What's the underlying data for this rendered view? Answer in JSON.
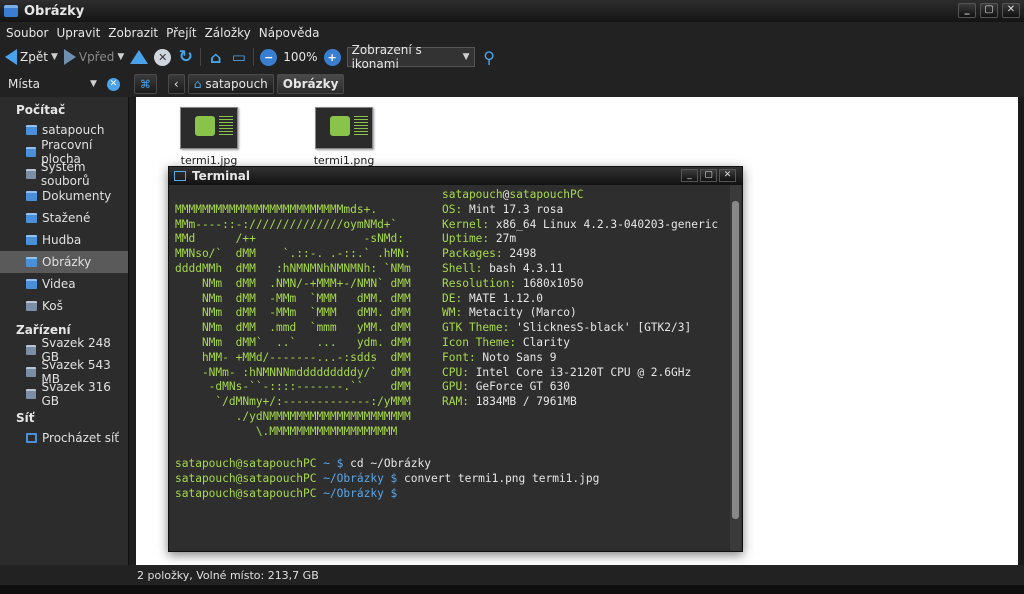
{
  "window": {
    "title": "Obrázky",
    "buttons": [
      "_",
      "▢",
      "✕"
    ]
  },
  "menu": [
    "Soubor",
    "Upravit",
    "Zobrazit",
    "Přejít",
    "Záložky",
    "Nápověda"
  ],
  "toolbar": {
    "back_label": "Zpět",
    "forward_label": "Vpřed",
    "zoom_level": "100%",
    "view_mode": "Zobrazení s ikonami"
  },
  "location": {
    "places_label": "Místa",
    "breadcrumbs": [
      "satapouch",
      "Obrázky"
    ]
  },
  "sidebar": {
    "sections": [
      {
        "title": "Počítač",
        "items": [
          {
            "label": "satapouch",
            "icon": "home-folder-icon"
          },
          {
            "label": "Pracovní plocha",
            "icon": "desktop-icon"
          },
          {
            "label": "Systém souborů",
            "icon": "filesystem-icon"
          },
          {
            "label": "Dokumenty",
            "icon": "folder-icon"
          },
          {
            "label": "Stažené",
            "icon": "folder-icon"
          },
          {
            "label": "Hudba",
            "icon": "folder-icon"
          },
          {
            "label": "Obrázky",
            "icon": "folder-icon",
            "selected": true
          },
          {
            "label": "Videa",
            "icon": "folder-icon"
          },
          {
            "label": "Koš",
            "icon": "trash-icon"
          }
        ]
      },
      {
        "title": "Zařízení",
        "items": [
          {
            "label": "Svazek 248 GB",
            "icon": "drive-icon"
          },
          {
            "label": "Svazek 543 MB",
            "icon": "drive-icon"
          },
          {
            "label": "Svazek 316 GB",
            "icon": "drive-icon"
          }
        ]
      },
      {
        "title": "Síť",
        "items": [
          {
            "label": "Procházet síť",
            "icon": "network-icon"
          }
        ]
      }
    ]
  },
  "files": [
    {
      "name": "termi1.jpg"
    },
    {
      "name": "termi1.png"
    }
  ],
  "terminal": {
    "title": "Terminal",
    "ascii_art": [
      "",
      "MMMMMMMMMMMMMMMMMMMMMMMMMmds+.",
      "MMm----::-://////////////oymNMd+`",
      "MMd      /++                -sNMd:",
      "MMNso/`  dMM    `.::-. .-::.` .hMN:",
      "ddddMMh  dMM   :hNMNMNhNMNMNh: `NMm",
      "    NMm  dMM  .NMN/-+MMM+-/NMN` dMM",
      "    NMm  dMM  -MMm  `MMM   dMM. dMM",
      "    NMm  dMM  -MMm  `MMM   dMM. dMM",
      "    NMm  dMM  .mmd  `mmm   yMM. dMM",
      "    NMm  dMM`  ..`   ...   ydm. dMM",
      "    hMM- +MMd/-------...-:sdds  dMM",
      "    -NMm- :hNMNNNmdddddddddy/`  dMM",
      "     -dMNs-``-::::-------.``    dMM",
      "      `/dMNmy+/:-------------:/yMMM",
      "         ./ydNMMMMMMMMMMMMMMMMMMMMM",
      "            \\.MMMMMMMMMMMMMMMMMMM"
    ],
    "user_host": "satapouch@satapouchPC",
    "info": [
      {
        "key": "OS:",
        "value": "Mint 17.3 rosa"
      },
      {
        "key": "Kernel:",
        "value": "x86_64 Linux 4.2.3-040203-generic"
      },
      {
        "key": "Uptime:",
        "value": "27m"
      },
      {
        "key": "Packages:",
        "value": "2498"
      },
      {
        "key": "Shell:",
        "value": "bash 4.3.11"
      },
      {
        "key": "Resolution:",
        "value": "1680x1050"
      },
      {
        "key": "DE:",
        "value": "MATE 1.12.0"
      },
      {
        "key": "WM:",
        "value": "Metacity (Marco)"
      },
      {
        "key": "GTK Theme:",
        "value": "'SlicknesS-black' [GTK2/3]"
      },
      {
        "key": "Icon Theme:",
        "value": "Clarity"
      },
      {
        "key": "Font:",
        "value": "Noto Sans 9"
      },
      {
        "key": "CPU:",
        "value": "Intel Core i3-2120T CPU @ 2.6GHz"
      },
      {
        "key": "GPU:",
        "value": "GeForce GT 630"
      },
      {
        "key": "RAM:",
        "value": "1834MB / 7961MB"
      }
    ],
    "prompts": [
      {
        "user": "satapouch@satapouchPC",
        "path": "~",
        "symbol": "$",
        "command": "cd ~/Obrázky"
      },
      {
        "user": "satapouch@satapouchPC",
        "path": "~/Obrázky",
        "symbol": "$",
        "command": "convert termi1.png termi1.jpg"
      },
      {
        "user": "satapouch@satapouchPC",
        "path": "~/Obrázky",
        "symbol": "$",
        "command": ""
      }
    ],
    "colors": {
      "green": "#a6d94a",
      "blue": "#5aa7e8"
    }
  },
  "status": {
    "text": "2 položky, Volné místo: 213,7 GB"
  }
}
